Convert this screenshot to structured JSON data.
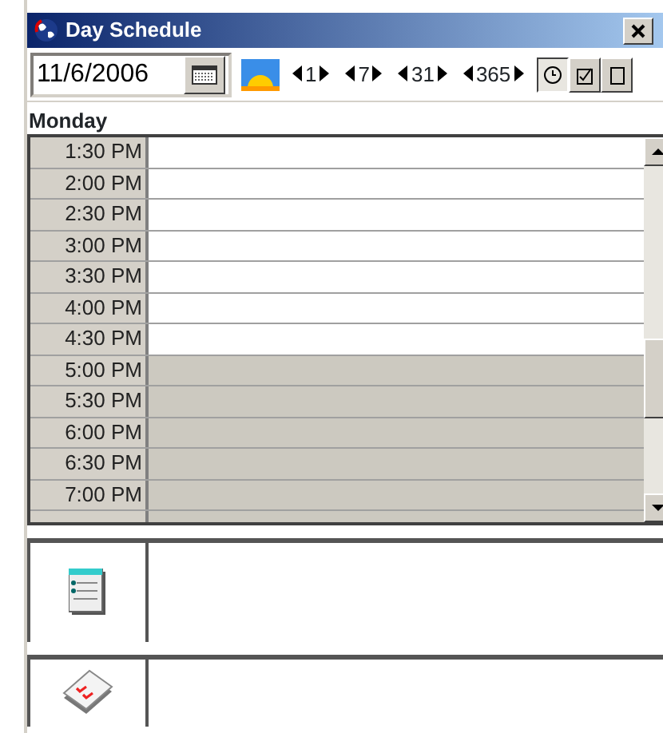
{
  "window": {
    "title": "Day Schedule"
  },
  "toolbar": {
    "date": "11/6/2006",
    "steps": [
      "1",
      "7",
      "31",
      "365"
    ],
    "views": [
      {
        "kind": "clock",
        "selected": true
      },
      {
        "kind": "task",
        "selected": false
      },
      {
        "kind": "note",
        "selected": false
      }
    ]
  },
  "day": "Monday",
  "slots": [
    {
      "time": "1:30 PM",
      "working": true
    },
    {
      "time": "2:00 PM",
      "working": true
    },
    {
      "time": "2:30 PM",
      "working": true
    },
    {
      "time": "3:00 PM",
      "working": true
    },
    {
      "time": "3:30 PM",
      "working": true
    },
    {
      "time": "4:00 PM",
      "working": true
    },
    {
      "time": "4:30 PM",
      "working": true
    },
    {
      "time": "5:00 PM",
      "working": false
    },
    {
      "time": "5:30 PM",
      "working": false
    },
    {
      "time": "6:00 PM",
      "working": false
    },
    {
      "time": "6:30 PM",
      "working": false
    },
    {
      "time": "7:00 PM",
      "working": false
    }
  ],
  "panels": [
    {
      "kind": "notes"
    },
    {
      "kind": "tasks"
    }
  ]
}
